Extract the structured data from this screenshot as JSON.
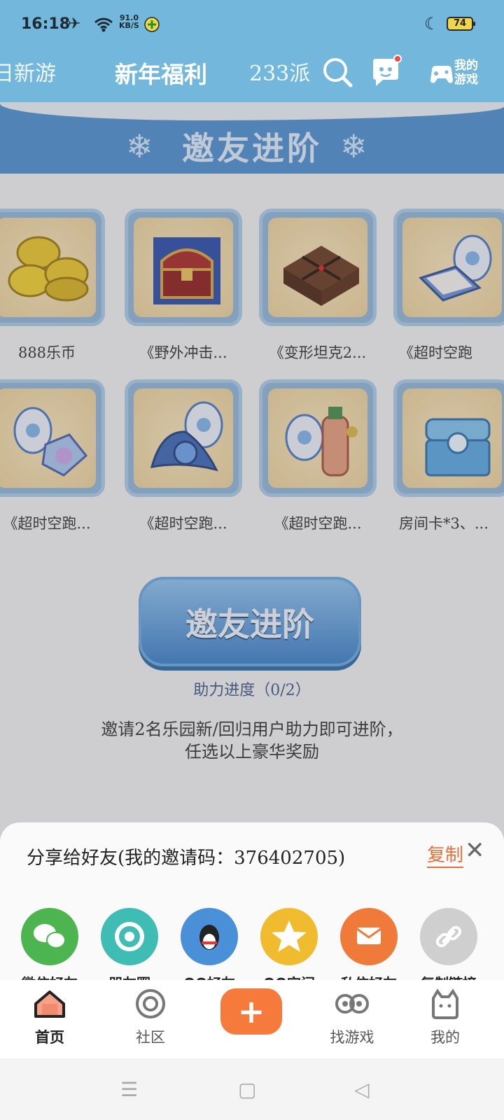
{
  "status": {
    "time": "16:18",
    "netspeed_value": "91.0",
    "netspeed_unit": "KB/S",
    "battery": "74"
  },
  "topnav": {
    "tabs": [
      {
        "label": "日新游",
        "active": false
      },
      {
        "label": "新年福利",
        "active": true
      },
      {
        "label": "233派",
        "active": false
      }
    ],
    "mygame_label": "我的游戏"
  },
  "banner": {
    "title": "邀友进阶"
  },
  "rewards": [
    {
      "label": "888乐币",
      "icon": "coins"
    },
    {
      "label": "《野外冲击...",
      "icon": "treasure-chest"
    },
    {
      "label": "《变形坦克2...",
      "icon": "gift-box"
    },
    {
      "label": "《超时空跑",
      "icon": "magic-book-egg"
    },
    {
      "label": "《超时空跑...",
      "icon": "crystal-egg"
    },
    {
      "label": "《超时空跑...",
      "icon": "cape-orb-egg"
    },
    {
      "label": "《超时空跑...",
      "icon": "potion-egg"
    },
    {
      "label": "房间卡*3、...",
      "icon": "blue-chest"
    }
  ],
  "cta": {
    "label": "邀友进阶",
    "progress": "助力进度（0/2）"
  },
  "description": {
    "line1": "邀请2名乐园新/回归用户助力即可进阶，",
    "line2": "任选以上豪华奖励"
  },
  "share": {
    "title": "分享给好友(我的邀请码：376402705)",
    "copy_label": "复制",
    "items": [
      {
        "label": "微信好友",
        "icon": "wechat-icon",
        "color": "#4cb54f"
      },
      {
        "label": "朋友圈",
        "icon": "moments-icon",
        "color": "#3fbcb3"
      },
      {
        "label": "QQ好友",
        "icon": "qq-icon",
        "color": "#4a90d9"
      },
      {
        "label": "QQ空间",
        "icon": "qzone-icon",
        "color": "#f0bb2e"
      },
      {
        "label": "私信好友",
        "icon": "mail-icon",
        "color": "#ef7a3a"
      },
      {
        "label": "复制链接",
        "icon": "link-icon",
        "color": "#cfcfcf"
      }
    ]
  },
  "bottomnav": {
    "items": [
      {
        "label": "首页",
        "active": true
      },
      {
        "label": "社区",
        "active": false
      },
      {
        "label": "找游戏",
        "active": false
      },
      {
        "label": "我的",
        "active": false
      }
    ]
  }
}
